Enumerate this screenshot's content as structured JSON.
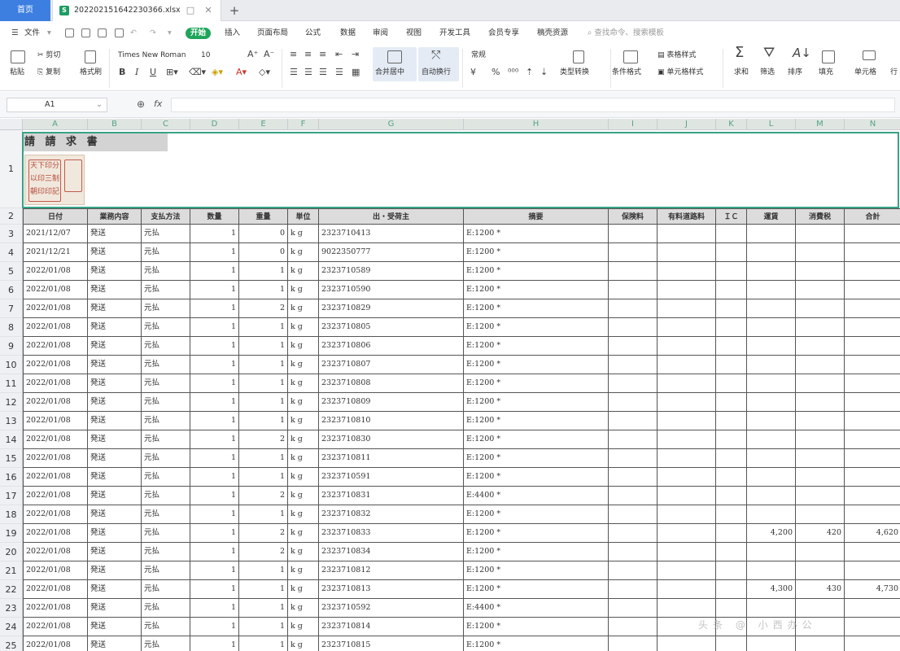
{
  "app": {
    "home_tab": "首页",
    "file_name": "20220215164223036​6.xlsx",
    "tab_box_icon": "□",
    "tab_close_icon": "✕",
    "new_tab_icon": "+"
  },
  "menu": {
    "file": "文件",
    "tabs": [
      "开始",
      "插入",
      "页面布局",
      "公式",
      "数据",
      "审阅",
      "视图",
      "开发工具",
      "会员专享",
      "稿壳资源"
    ],
    "active_tab": "开始",
    "search": "查找命令、搜索模板"
  },
  "ribbon": {
    "paste": "粘贴",
    "cut": "剪切",
    "copy": "复制",
    "format_painter": "格式刷",
    "font_name": "Times New Roman",
    "font_size": "10",
    "bold": "B",
    "italic": "I",
    "underline": "U",
    "merge_center": "合并居中",
    "wrap_text": "自动换行",
    "number_format": "常规",
    "currency": "¥",
    "percent": "%",
    "type_convert": "类型转换",
    "conditional_format": "条件格式",
    "table_style": "表格样式",
    "cell_style": "单元格样式",
    "sum": "求和",
    "filter": "筛选",
    "sort": "排序",
    "fill": "填充",
    "cell": "单元格",
    "row_col": "行"
  },
  "formula_bar": {
    "cell_ref": "A1",
    "zoom_icon": "🔍",
    "fx": "fx",
    "value": ""
  },
  "sheet": {
    "col_letters": [
      "A",
      "B",
      "C",
      "D",
      "E",
      "F",
      "G",
      "H",
      "I",
      "J",
      "K",
      "L",
      "M",
      "N"
    ],
    "title": "請 請 求 書",
    "stamp_lines": [
      "天下印分",
      "以印三制",
      "朝印印記"
    ],
    "headers": [
      "日付",
      "業務内容",
      "支払方法",
      "数量",
      "重量",
      "単位",
      "出・受荷主",
      "摘要",
      "保険料",
      "有料道路料",
      "ＩＣ",
      "運賃",
      "消費税",
      "合計"
    ],
    "rows": [
      {
        "n": "3",
        "date": "2021/12/07",
        "biz": "発送",
        "pay": "元払",
        "qty": "1",
        "wt": "0",
        "unit": "k g",
        "party": "2323710413",
        "memo": "E:1200 *",
        "fee": "",
        "tax": "",
        "total": ""
      },
      {
        "n": "4",
        "date": "2021/12/21",
        "biz": "発送",
        "pay": "元払",
        "qty": "1",
        "wt": "0",
        "unit": "k g",
        "party": "9022350777",
        "memo": "E:1200 *",
        "fee": "",
        "tax": "",
        "total": ""
      },
      {
        "n": "5",
        "date": "2022/01/08",
        "biz": "発送",
        "pay": "元払",
        "qty": "1",
        "wt": "1",
        "unit": "k g",
        "party": "2323710589",
        "memo": "E:1200 *",
        "fee": "",
        "tax": "",
        "total": ""
      },
      {
        "n": "6",
        "date": "2022/01/08",
        "biz": "発送",
        "pay": "元払",
        "qty": "1",
        "wt": "1",
        "unit": "k g",
        "party": "2323710590",
        "memo": "E:1200 *",
        "fee": "",
        "tax": "",
        "total": ""
      },
      {
        "n": "7",
        "date": "2022/01/08",
        "biz": "発送",
        "pay": "元払",
        "qty": "1",
        "wt": "2",
        "unit": "k g",
        "party": "2323710829",
        "memo": "E:1200 *",
        "fee": "",
        "tax": "",
        "total": ""
      },
      {
        "n": "8",
        "date": "2022/01/08",
        "biz": "発送",
        "pay": "元払",
        "qty": "1",
        "wt": "1",
        "unit": "k g",
        "party": "2323710805",
        "memo": "E:1200 *",
        "fee": "",
        "tax": "",
        "total": ""
      },
      {
        "n": "9",
        "date": "2022/01/08",
        "biz": "発送",
        "pay": "元払",
        "qty": "1",
        "wt": "1",
        "unit": "k g",
        "party": "2323710806",
        "memo": "E:1200 *",
        "fee": "",
        "tax": "",
        "total": ""
      },
      {
        "n": "10",
        "date": "2022/01/08",
        "biz": "発送",
        "pay": "元払",
        "qty": "1",
        "wt": "1",
        "unit": "k g",
        "party": "2323710807",
        "memo": "E:1200 *",
        "fee": "",
        "tax": "",
        "total": ""
      },
      {
        "n": "11",
        "date": "2022/01/08",
        "biz": "発送",
        "pay": "元払",
        "qty": "1",
        "wt": "1",
        "unit": "k g",
        "party": "2323710808",
        "memo": "E:1200 *",
        "fee": "",
        "tax": "",
        "total": ""
      },
      {
        "n": "12",
        "date": "2022/01/08",
        "biz": "発送",
        "pay": "元払",
        "qty": "1",
        "wt": "1",
        "unit": "k g",
        "party": "2323710809",
        "memo": "E:1200 *",
        "fee": "",
        "tax": "",
        "total": ""
      },
      {
        "n": "13",
        "date": "2022/01/08",
        "biz": "発送",
        "pay": "元払",
        "qty": "1",
        "wt": "1",
        "unit": "k g",
        "party": "2323710810",
        "memo": "E:1200 *",
        "fee": "",
        "tax": "",
        "total": ""
      },
      {
        "n": "14",
        "date": "2022/01/08",
        "biz": "発送",
        "pay": "元払",
        "qty": "1",
        "wt": "2",
        "unit": "k g",
        "party": "2323710830",
        "memo": "E:1200 *",
        "fee": "",
        "tax": "",
        "total": ""
      },
      {
        "n": "15",
        "date": "2022/01/08",
        "biz": "発送",
        "pay": "元払",
        "qty": "1",
        "wt": "1",
        "unit": "k g",
        "party": "2323710811",
        "memo": "E:1200 *",
        "fee": "",
        "tax": "",
        "total": ""
      },
      {
        "n": "16",
        "date": "2022/01/08",
        "biz": "発送",
        "pay": "元払",
        "qty": "1",
        "wt": "1",
        "unit": "k g",
        "party": "2323710591",
        "memo": "E:1200 *",
        "fee": "",
        "tax": "",
        "total": ""
      },
      {
        "n": "17",
        "date": "2022/01/08",
        "biz": "発送",
        "pay": "元払",
        "qty": "1",
        "wt": "2",
        "unit": "k g",
        "party": "2323710831",
        "memo": "E:4400 *",
        "fee": "",
        "tax": "",
        "total": ""
      },
      {
        "n": "18",
        "date": "2022/01/08",
        "biz": "発送",
        "pay": "元払",
        "qty": "1",
        "wt": "1",
        "unit": "k g",
        "party": "2323710832",
        "memo": "E:1200 *",
        "fee": "",
        "tax": "",
        "total": ""
      },
      {
        "n": "19",
        "date": "2022/01/08",
        "biz": "発送",
        "pay": "元払",
        "qty": "1",
        "wt": "2",
        "unit": "k g",
        "party": "2323710833",
        "memo": "E:1200 *",
        "fee": "4,200",
        "tax": "420",
        "total": "4,620"
      },
      {
        "n": "20",
        "date": "2022/01/08",
        "biz": "発送",
        "pay": "元払",
        "qty": "1",
        "wt": "2",
        "unit": "k g",
        "party": "2323710834",
        "memo": "E:1200 *",
        "fee": "",
        "tax": "",
        "total": ""
      },
      {
        "n": "21",
        "date": "2022/01/08",
        "biz": "発送",
        "pay": "元払",
        "qty": "1",
        "wt": "1",
        "unit": "k g",
        "party": "2323710812",
        "memo": "E:1200 *",
        "fee": "",
        "tax": "",
        "total": ""
      },
      {
        "n": "22",
        "date": "2022/01/08",
        "biz": "発送",
        "pay": "元払",
        "qty": "1",
        "wt": "1",
        "unit": "k g",
        "party": "2323710813",
        "memo": "E:1200 *",
        "fee": "4,300",
        "tax": "430",
        "total": "4,730"
      },
      {
        "n": "23",
        "date": "2022/01/08",
        "biz": "発送",
        "pay": "元払",
        "qty": "1",
        "wt": "1",
        "unit": "k g",
        "party": "2323710592",
        "memo": "E:4400 *",
        "fee": "",
        "tax": "",
        "total": ""
      },
      {
        "n": "24",
        "date": "2022/01/08",
        "biz": "発送",
        "pay": "元払",
        "qty": "1",
        "wt": "1",
        "unit": "k g",
        "party": "2323710814",
        "memo": "E:1200 *",
        "fee": "",
        "tax": "",
        "total": ""
      },
      {
        "n": "25",
        "date": "2022/01/08",
        "biz": "発送",
        "pay": "元払",
        "qty": "1",
        "wt": "1",
        "unit": "k g",
        "party": "2323710815",
        "memo": "E:1200 *",
        "fee": "",
        "tax": "",
        "total": ""
      }
    ]
  },
  "watermark": "头条 @ 小西办公"
}
